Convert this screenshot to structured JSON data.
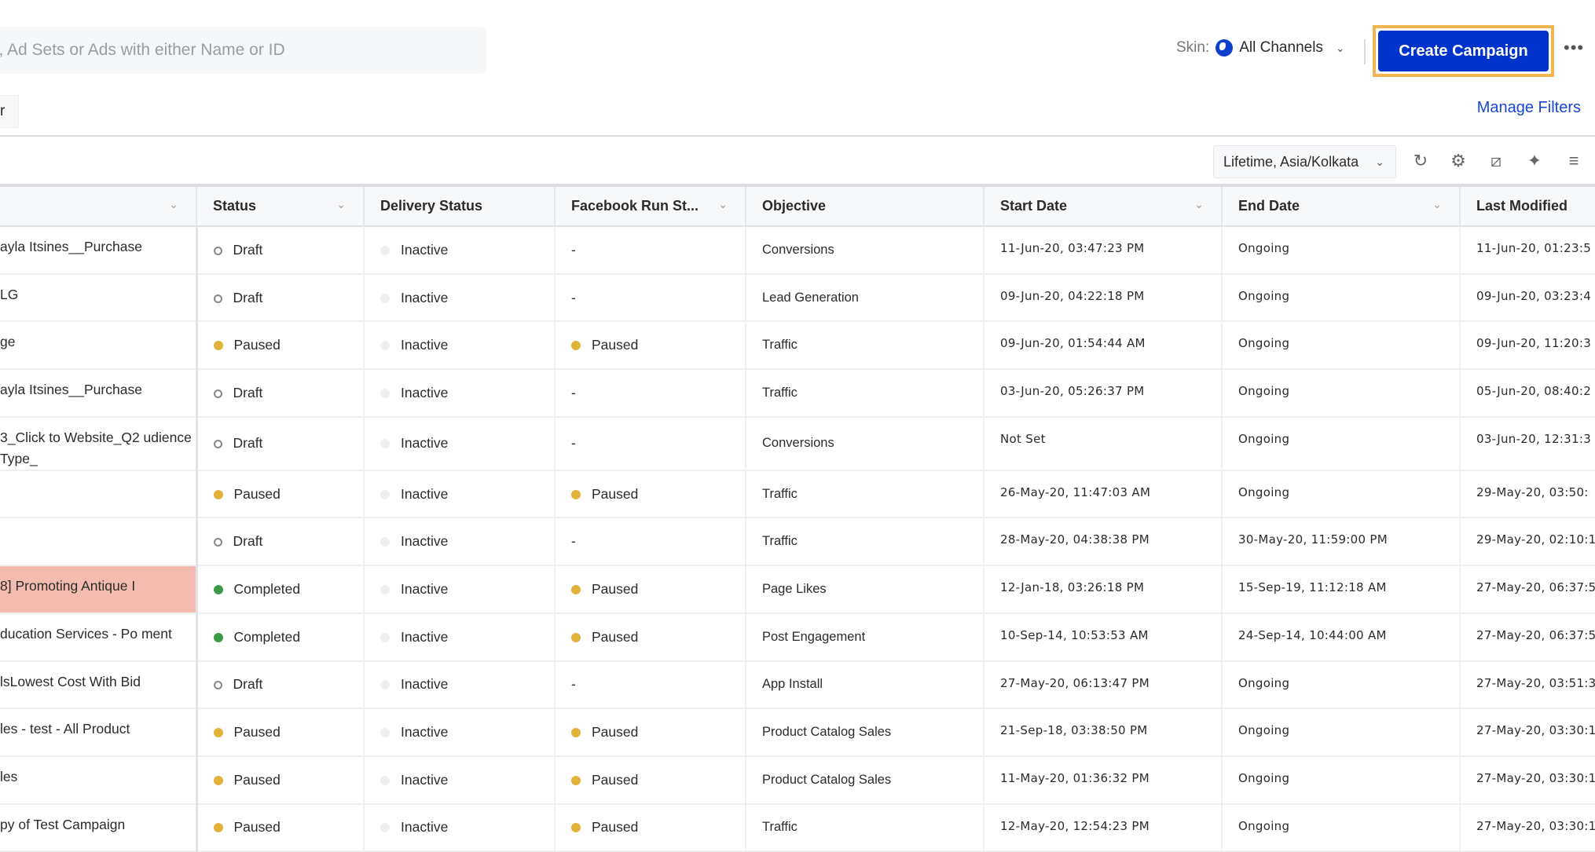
{
  "header": {
    "search_placeholder": "s, Ad Sets or Ads with either Name or ID",
    "skin_label": "Skin:",
    "skin_value": "All Channels",
    "create_button": "Create Campaign",
    "more_icon": "more-horizontal-icon",
    "filter_button_partial": "r",
    "manage_filters": "Manage Filters"
  },
  "toolbar": {
    "date_range": "Lifetime, Asia/Kolkata",
    "icons": [
      "refresh-icon",
      "settings-icon",
      "tag-icon",
      "magic-wand-icon",
      "add-column-icon"
    ]
  },
  "colors": {
    "accent": "#0033cc",
    "highlight": "#f2b450",
    "paused": "#e2b23a",
    "completed": "#3a9a48",
    "link": "#1846d4"
  },
  "table": {
    "columns": [
      "",
      "Status",
      "Delivery Status",
      "Facebook Run St...",
      "Objective",
      "Start Date",
      "End Date",
      "Last Modified"
    ],
    "rows": [
      {
        "name": "ayla Itsines__Purchase",
        "status": "Draft",
        "delivery": "Inactive",
        "fb": "-",
        "objective": "Conversions",
        "start": "11-Jun-20, 03:47:23 PM",
        "end": "Ongoing",
        "modified": "11-Jun-20, 01:23:5"
      },
      {
        "name": "LG",
        "status": "Draft",
        "delivery": "Inactive",
        "fb": "-",
        "objective": "Lead Generation",
        "start": "09-Jun-20, 04:22:18 PM",
        "end": "Ongoing",
        "modified": "09-Jun-20, 03:23:4"
      },
      {
        "name": "ge",
        "status": "Paused",
        "delivery": "Inactive",
        "fb": "Paused",
        "objective": "Traffic",
        "start": "09-Jun-20, 01:54:44 AM",
        "end": "Ongoing",
        "modified": "09-Jun-20, 11:20:3"
      },
      {
        "name": "ayla Itsines__Purchase",
        "status": "Draft",
        "delivery": "Inactive",
        "fb": "-",
        "objective": "Traffic",
        "start": "03-Jun-20, 05:26:37 PM",
        "end": "Ongoing",
        "modified": "05-Jun-20, 08:40:2"
      },
      {
        "name": "3_Click to Website_Q2 udience Type_",
        "status": "Draft",
        "delivery": "Inactive",
        "fb": "-",
        "objective": "Conversions",
        "start": "Not Set",
        "end": "Ongoing",
        "modified": "03-Jun-20, 12:31:3"
      },
      {
        "name": "",
        "status": "Paused",
        "delivery": "Inactive",
        "fb": "Paused",
        "objective": "Traffic",
        "start": "26-May-20, 11:47:03 AM",
        "end": "Ongoing",
        "modified": "29-May-20, 03:50:"
      },
      {
        "name": "",
        "status": "Draft",
        "delivery": "Inactive",
        "fb": "-",
        "objective": "Traffic",
        "start": "28-May-20, 04:38:38 PM",
        "end": "30-May-20, 11:59:00 PM",
        "modified": "29-May-20, 02:10:1"
      },
      {
        "name": "8] Promoting Antique I",
        "status": "Completed",
        "delivery": "Inactive",
        "fb": "Paused",
        "objective": "Page Likes",
        "start": "12-Jan-18, 03:26:18 PM",
        "end": "15-Sep-19, 11:12:18 AM",
        "modified": "27-May-20, 06:37:5",
        "highlight": true
      },
      {
        "name": "ducation Services - Po ment",
        "status": "Completed",
        "delivery": "Inactive",
        "fb": "Paused",
        "objective": "Post Engagement",
        "start": "10-Sep-14, 10:53:53 AM",
        "end": "24-Sep-14, 10:44:00 AM",
        "modified": "27-May-20, 06:37:5"
      },
      {
        "name": "lsLowest Cost With Bid",
        "status": "Draft",
        "delivery": "Inactive",
        "fb": "-",
        "objective": "App Install",
        "start": "27-May-20, 06:13:47 PM",
        "end": "Ongoing",
        "modified": "27-May-20, 03:51:3"
      },
      {
        "name": "les - test - All Product",
        "status": "Paused",
        "delivery": "Inactive",
        "fb": "Paused",
        "objective": "Product Catalog Sales",
        "start": "21-Sep-18, 03:38:50 PM",
        "end": "Ongoing",
        "modified": "27-May-20, 03:30:1"
      },
      {
        "name": "les",
        "status": "Paused",
        "delivery": "Inactive",
        "fb": "Paused",
        "objective": "Product Catalog Sales",
        "start": "11-May-20, 01:36:32 PM",
        "end": "Ongoing",
        "modified": "27-May-20, 03:30:1"
      },
      {
        "name": "py of Test Campaign",
        "status": "Paused",
        "delivery": "Inactive",
        "fb": "Paused",
        "objective": "Traffic",
        "start": "12-May-20, 12:54:23 PM",
        "end": "Ongoing",
        "modified": "27-May-20, 03:30:1"
      }
    ]
  }
}
